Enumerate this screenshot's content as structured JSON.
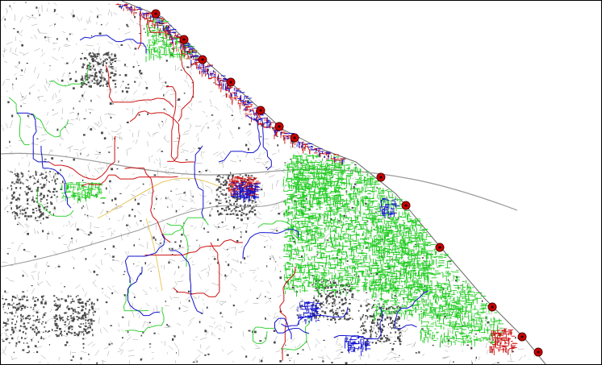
{
  "map": {
    "colors": {
      "background": "#ffffff",
      "sea": "#ffffff",
      "base_lines": "#8a8a8a",
      "buildings": "#4a4a4a",
      "network_green": "#22cc22",
      "network_red": "#cc1111",
      "network_blue": "#1111cc",
      "road_yellow": "#e8c860",
      "marker_fill": "#cc0000",
      "marker_stroke": "#550000",
      "border": "#000000"
    },
    "markers": [
      {
        "name": "marker-1",
        "icon": "red-dot-marker-icon"
      },
      {
        "name": "marker-2",
        "icon": "red-dot-marker-icon"
      },
      {
        "name": "marker-3",
        "icon": "red-dot-marker-icon"
      },
      {
        "name": "marker-4",
        "icon": "red-dot-marker-icon"
      },
      {
        "name": "marker-5",
        "icon": "red-dot-marker-icon"
      },
      {
        "name": "marker-6",
        "icon": "red-dot-marker-icon"
      },
      {
        "name": "marker-7",
        "icon": "red-dot-marker-icon"
      },
      {
        "name": "marker-8",
        "icon": "red-dot-marker-icon"
      },
      {
        "name": "marker-9",
        "icon": "red-dot-marker-icon"
      },
      {
        "name": "marker-10",
        "icon": "red-dot-marker-icon"
      },
      {
        "name": "marker-11",
        "icon": "red-dot-marker-icon"
      },
      {
        "name": "marker-12",
        "icon": "red-dot-marker-icon"
      },
      {
        "name": "marker-13",
        "icon": "red-dot-marker-icon"
      }
    ]
  }
}
